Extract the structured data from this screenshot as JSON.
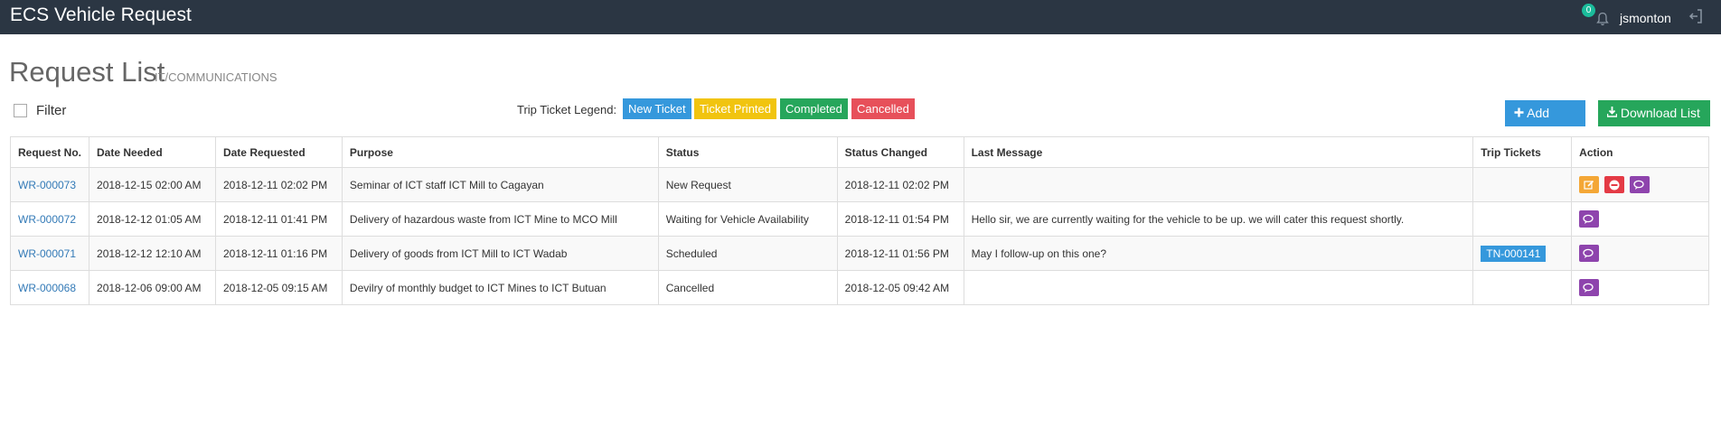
{
  "app": {
    "title": "ECS Vehicle Request"
  },
  "header": {
    "notification_count": "0",
    "username": "jsmonton"
  },
  "page": {
    "title": "Request List",
    "subtitle": "IT/COMMUNICATIONS"
  },
  "filter": {
    "label": "Filter"
  },
  "legend": {
    "label": "Trip Ticket Legend:",
    "items": [
      {
        "label": "New Ticket",
        "color": "#3598dc"
      },
      {
        "label": "Ticket Printed",
        "color": "#f1c40f"
      },
      {
        "label": "Completed",
        "color": "#26a65b"
      },
      {
        "label": "Cancelled",
        "color": "#e7505a"
      }
    ]
  },
  "buttons": {
    "add_new": "Add New",
    "download_list": "Download List"
  },
  "table": {
    "headers": [
      "Request No.",
      "Date Needed",
      "Date Requested",
      "Purpose",
      "Status",
      "Status Changed",
      "Last Message",
      "Trip Tickets",
      "Action"
    ],
    "rows": [
      {
        "request_no": "WR-000073",
        "date_needed": "2018-12-15 02:00 AM",
        "date_requested": "2018-12-11 02:02 PM",
        "purpose": "Seminar of ICT staff ICT Mill to Cagayan",
        "status": "New Request",
        "status_changed": "2018-12-11 02:02 PM",
        "last_message": "",
        "trip_ticket": ""
      },
      {
        "request_no": "WR-000072",
        "date_needed": "2018-12-12 01:05 AM",
        "date_requested": "2018-12-11 01:41 PM",
        "purpose": "Delivery of hazardous waste from ICT Mine to MCO Mill",
        "status": "Waiting for Vehicle Availability",
        "status_changed": "2018-12-11 01:54 PM",
        "last_message": "Hello sir, we are currently waiting for the vehicle to be up. we will cater this request shortly.",
        "trip_ticket": ""
      },
      {
        "request_no": "WR-000071",
        "date_needed": "2018-12-12 12:10 AM",
        "date_requested": "2018-12-11 01:16 PM",
        "purpose": "Delivery of goods from ICT Mill to ICT Wadab",
        "status": "Scheduled",
        "status_changed": "2018-12-11 01:56 PM",
        "last_message": "May I follow-up on this one?",
        "trip_ticket": "TN-000141"
      },
      {
        "request_no": "WR-000068",
        "date_needed": "2018-12-06 09:00 AM",
        "date_requested": "2018-12-05 09:15 AM",
        "purpose": "Devilry of monthly budget to ICT Mines to ICT Butuan",
        "status": "Cancelled",
        "status_changed": "2018-12-05 09:42 AM",
        "last_message": "",
        "trip_ticket": ""
      }
    ]
  },
  "colors": {
    "topbar": "#2b3643",
    "add_new": "#3598dc",
    "download": "#26a65b",
    "edit": "#f4a736",
    "cancel": "#e43a45",
    "message": "#8e44ad",
    "link": "#337ab7"
  },
  "icons": [
    "bell-icon",
    "logout-icon",
    "plus-icon",
    "download-icon",
    "edit-icon",
    "cancel-icon",
    "message-icon"
  ]
}
